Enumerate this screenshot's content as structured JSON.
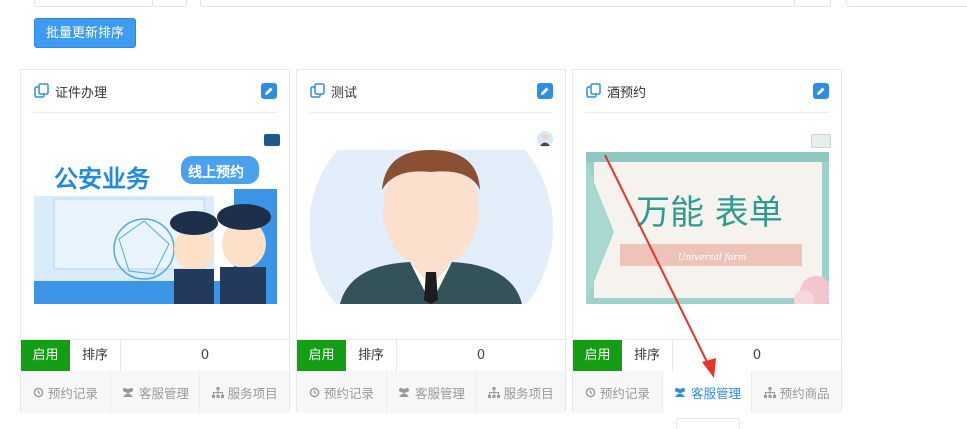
{
  "toolbar": {
    "batch_sort_label": "批量更新排序"
  },
  "cards": [
    {
      "title": "证件办理",
      "enable_label": "启用",
      "sort_label": "排序",
      "sort_value": "0",
      "banner_title": "公安业务",
      "banner_badge": "线上预约",
      "actions": [
        "预约记录",
        "客服管理",
        "服务项目"
      ]
    },
    {
      "title": "测试",
      "enable_label": "启用",
      "sort_label": "排序",
      "sort_value": "0",
      "actions": [
        "预约记录",
        "客服管理",
        "服务项目"
      ]
    },
    {
      "title": "酒预约",
      "enable_label": "启用",
      "sort_label": "排序",
      "sort_value": "0",
      "banner_title": "万能 表单",
      "banner_sub": "Universal form",
      "actions": [
        "预约记录",
        "客服管理",
        "预约商品"
      ]
    }
  ],
  "colors": {
    "primary": "#3d9bf0",
    "enable_green": "#139e13",
    "active_link": "#2f8de4",
    "arrow_red": "#e8332c"
  }
}
